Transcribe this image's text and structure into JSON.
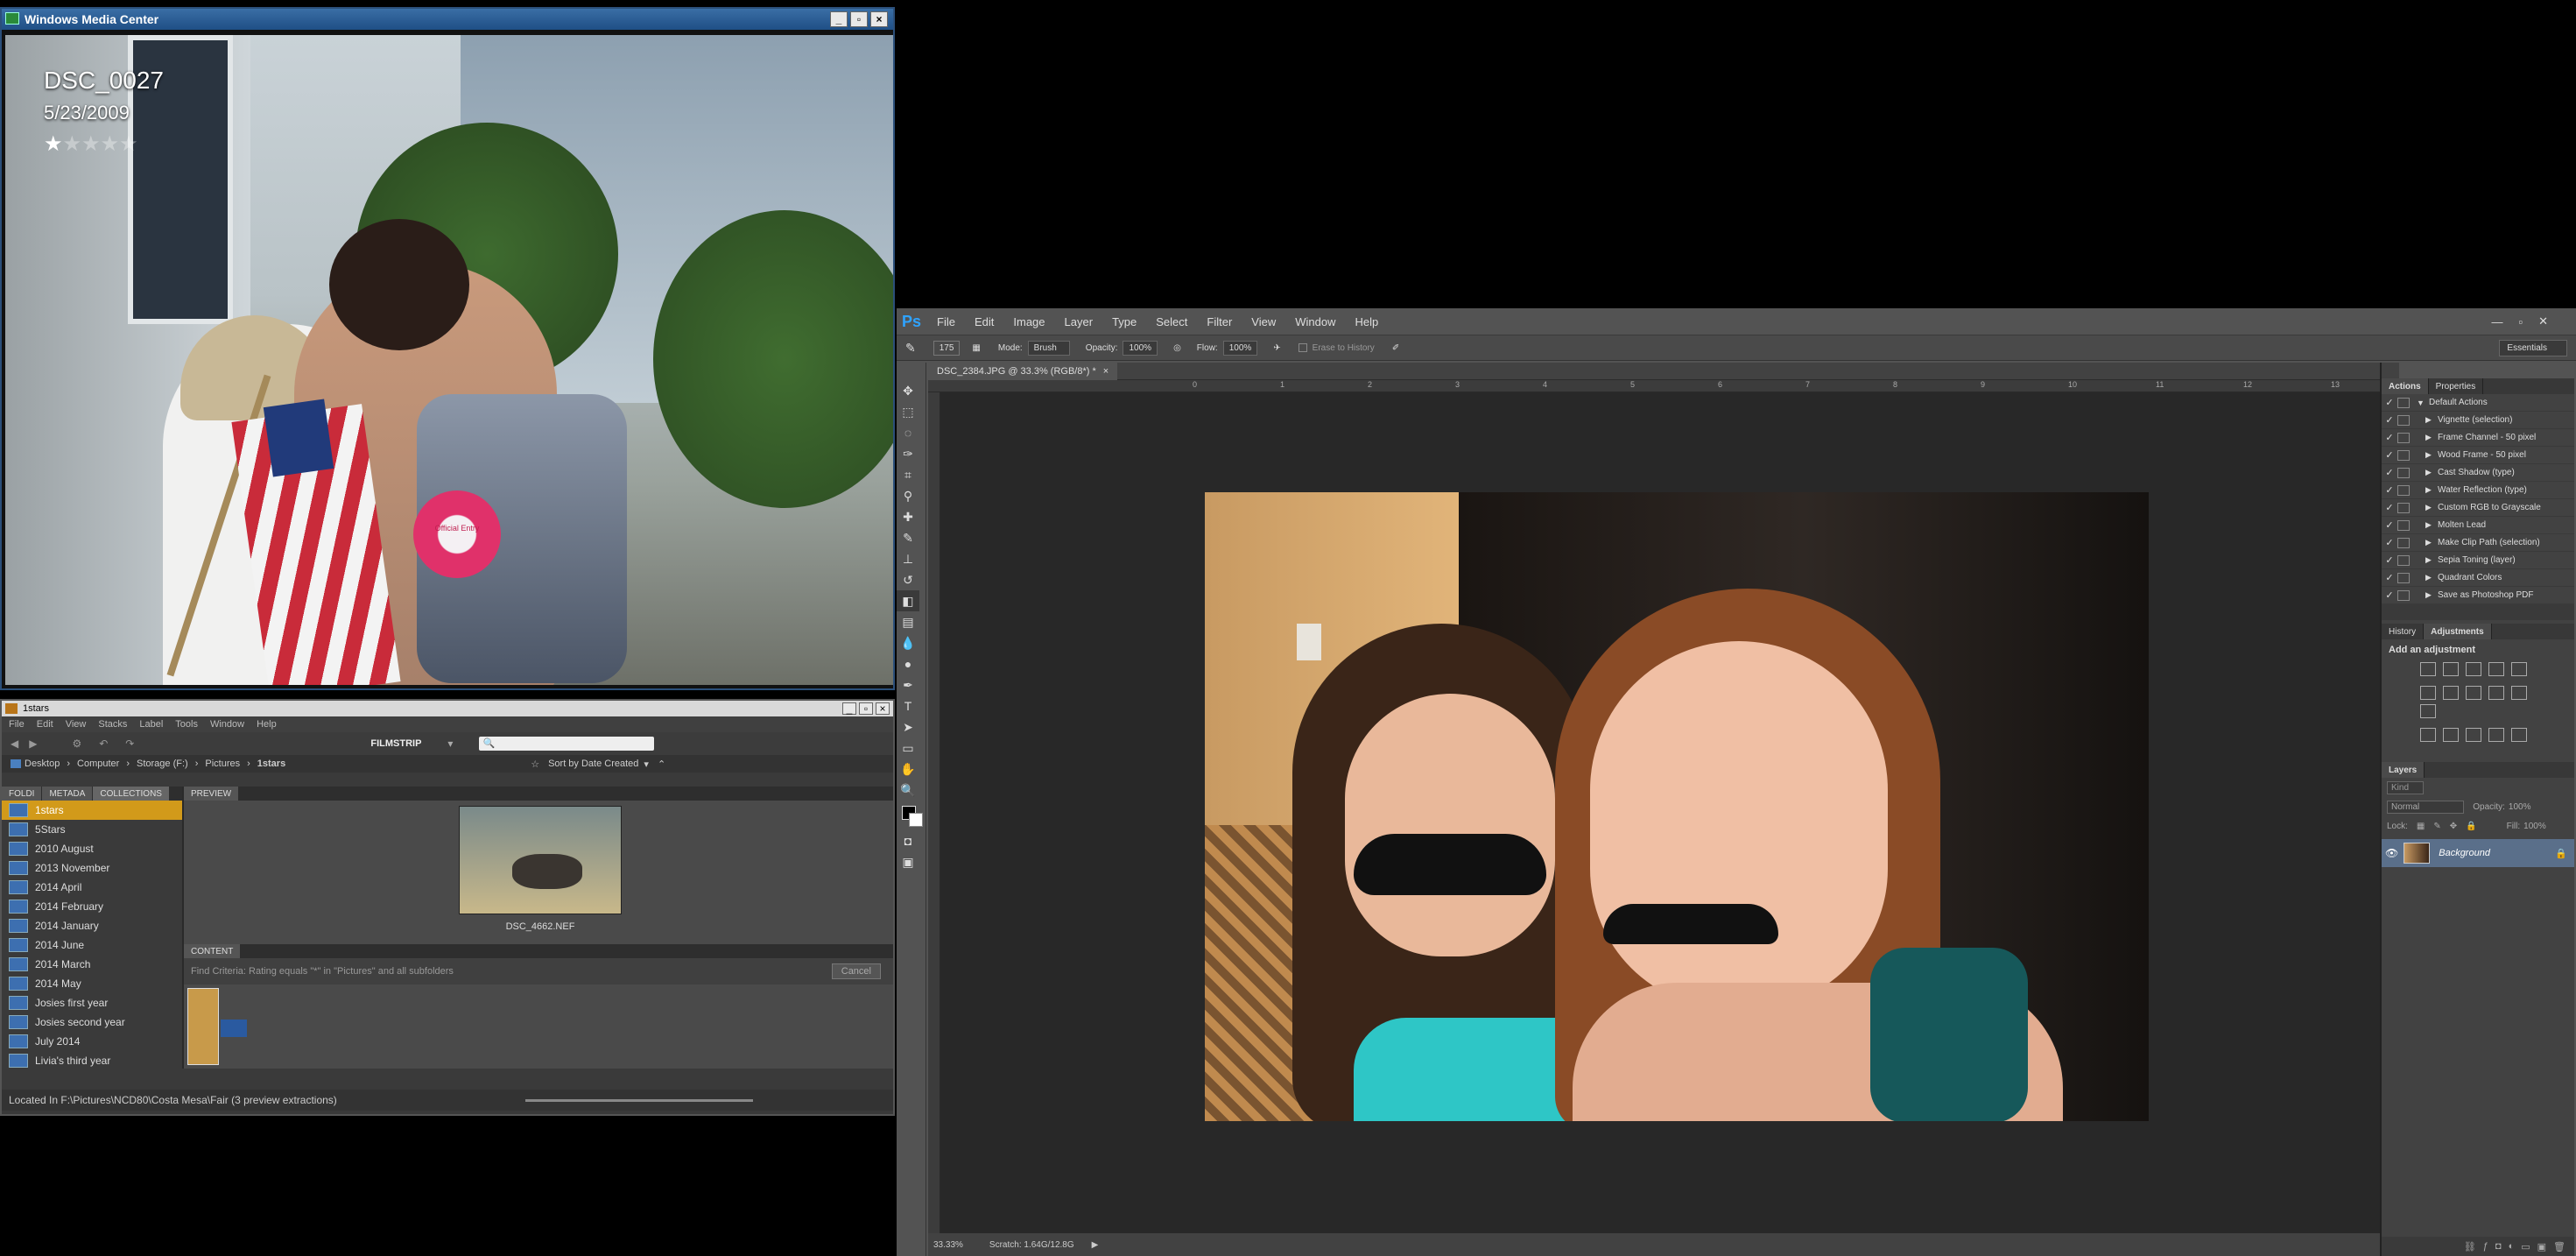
{
  "wmc": {
    "window_title": "Windows Media Center",
    "photo_name": "DSC_0027",
    "photo_date": "5/23/2009",
    "rating": 1,
    "rating_max": 5,
    "badge_text": "Official Entry",
    "star": "★"
  },
  "bridge": {
    "window_title": "1stars",
    "menu": [
      "File",
      "Edit",
      "View",
      "Stacks",
      "Label",
      "Tools",
      "Window",
      "Help"
    ],
    "workspace": "FILMSTRIP",
    "breadcrumb": [
      "Desktop",
      "Computer",
      "Storage (F:)",
      "Pictures",
      "1stars"
    ],
    "sort_label": "Sort by Date Created",
    "panel_tabs": [
      "FOLDI",
      "METADA",
      "COLLECTIONS"
    ],
    "collections": [
      "1stars",
      "5Stars",
      "2010 August",
      "2013 November",
      "2014 April",
      "2014 February",
      "2014 January",
      "2014 June",
      "2014 March",
      "2014 May",
      "Josies first year",
      "Josies second year",
      "July 2014",
      "Livia's third year"
    ],
    "selected_collection": "1stars",
    "preview_tab": "PREVIEW",
    "preview_filename": "DSC_4662.NEF",
    "content_tab": "CONTENT",
    "find_criteria": "Find Criteria: Rating equals \"*\" in \"Pictures\" and all subfolders",
    "cancel_label": "Cancel",
    "status": "Located In F:\\Pictures\\NCD80\\Costa Mesa\\Fair (3 preview extractions)"
  },
  "ps": {
    "logo": "Ps",
    "menu": [
      "File",
      "Edit",
      "Image",
      "Layer",
      "Type",
      "Select",
      "Filter",
      "View",
      "Window",
      "Help"
    ],
    "options": {
      "brush_size": "175",
      "mode_label": "Mode:",
      "mode_value": "Brush",
      "opacity_label": "Opacity:",
      "opacity_value": "100%",
      "flow_label": "Flow:",
      "flow_value": "100%",
      "erase_history": "Erase to History"
    },
    "workspace": "Essentials",
    "doc_tab": "DSC_2384.JPG @ 33.3% (RGB/8*) *",
    "ruler_marks": [
      "0",
      "1",
      "2",
      "3",
      "4",
      "5",
      "6",
      "7",
      "8",
      "9",
      "10",
      "11",
      "12",
      "13"
    ],
    "zoom": "33.33%",
    "scratch": "Scratch: 1.64G/12.8G",
    "actions_tabs": [
      "Actions",
      "Properties"
    ],
    "actions": [
      "Default Actions",
      "Vignette (selection)",
      "Frame Channel - 50 pixel",
      "Wood Frame - 50 pixel",
      "Cast Shadow (type)",
      "Water Reflection (type)",
      "Custom RGB to Grayscale",
      "Molten Lead",
      "Make Clip Path (selection)",
      "Sepia Toning (layer)",
      "Quadrant Colors",
      "Save as Photoshop PDF"
    ],
    "adj_tabs": [
      "History",
      "Adjustments"
    ],
    "adj_heading": "Add an adjustment",
    "layers_tab": "Layers",
    "layers_kind": "Kind",
    "blend_mode": "Normal",
    "opacity_label": "Opacity:",
    "opacity": "100%",
    "lock_label": "Lock:",
    "fill_label": "Fill:",
    "fill": "100%",
    "layer_name": "Background"
  }
}
